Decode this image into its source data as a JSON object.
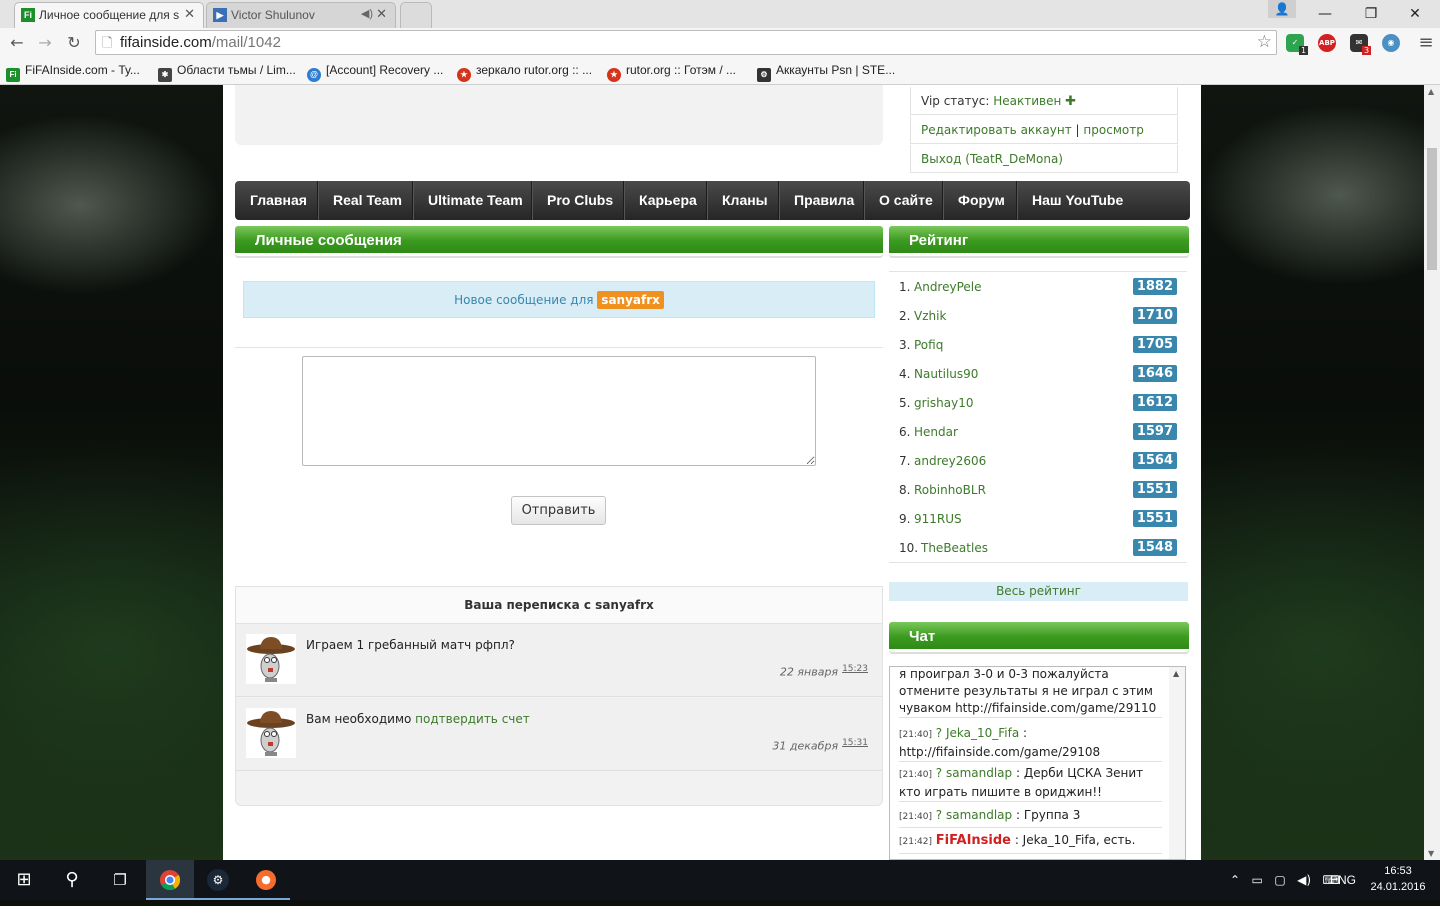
{
  "browser": {
    "tabs": [
      {
        "title": "Личное сообщение для s",
        "favicon": "fi-favicon"
      },
      {
        "title": "Victor Shulunov",
        "favicon": "video-favicon"
      }
    ],
    "url_host": "fifainside.com",
    "url_path": "/mail/1042",
    "ext_badges": {
      "shield": "1",
      "abp": "ABP",
      "mail": "3"
    },
    "bookmarks": [
      {
        "label": "FiFAInside.com - Ту...",
        "icon": "fi-favicon",
        "color": "#1b8f2a"
      },
      {
        "label": "Области тьмы / Lim...",
        "icon": "spider-icon",
        "color": "#444444"
      },
      {
        "label": "[Account] Recovery ...",
        "icon": "recovery-icon",
        "color": "#2f7dd1"
      },
      {
        "label": "зеркало rutor.org :: ...",
        "icon": "rutor-icon",
        "color": "#d4331c"
      },
      {
        "label": "rutor.org :: Готэм / ...",
        "icon": "rutor-icon",
        "color": "#d4331c"
      },
      {
        "label": "Аккаунты Psn | STE...",
        "icon": "steam-icon",
        "color": "#333333"
      }
    ]
  },
  "account": {
    "vip_label": "Vip статус:",
    "vip_value": "Неактивен",
    "edit_label": "Редактировать аккаунт",
    "separator": "|",
    "view_label": "просмотр",
    "logout_label": "Выход (TeatR_DeMona)"
  },
  "nav": [
    "Главная",
    "Real Team",
    "Ultimate Team",
    "Pro Clubs",
    "Карьера",
    "Кланы",
    "Правила",
    "О сайте",
    "Форум",
    "Наш YouTube"
  ],
  "pm": {
    "header": "Личные сообщения",
    "new_message_label": "Новое сообщение для",
    "recipient": "sanyafrx",
    "message_value": "",
    "send_label": "Отправить",
    "conversation_title": "Ваша переписка с sanyafrx",
    "messages": [
      {
        "text": "Играем 1 гребанный матч рфпл?",
        "link": "",
        "date": "22 января",
        "time": "15:23"
      },
      {
        "text": "Вам необходимо ",
        "link": "подтвердить счет",
        "date": "31 декабря",
        "time": "15:31"
      }
    ]
  },
  "rating": {
    "header": "Рейтинг",
    "entries": [
      {
        "rank": "1.",
        "name": "AndreyPele",
        "score": "1882"
      },
      {
        "rank": "2.",
        "name": "Vzhik",
        "score": "1710"
      },
      {
        "rank": "3.",
        "name": "Pofiq",
        "score": "1705"
      },
      {
        "rank": "4.",
        "name": "Nautilus90",
        "score": "1646"
      },
      {
        "rank": "5.",
        "name": "grishay10",
        "score": "1612"
      },
      {
        "rank": "6.",
        "name": "Hendar",
        "score": "1597"
      },
      {
        "rank": "7.",
        "name": "andrey2606",
        "score": "1564"
      },
      {
        "rank": "8.",
        "name": "RobinhoBLR",
        "score": "1551"
      },
      {
        "rank": "9.",
        "name": "911RUS",
        "score": "1551"
      },
      {
        "rank": "10.",
        "name": "TheBeatles",
        "score": "1548"
      }
    ],
    "all_label": "Весь рейтинг"
  },
  "chat": {
    "header": "Чат",
    "lines": [
      {
        "time": "",
        "user": "",
        "text": "я проиграл 3-0 и 0-3 пожалуйста отмените результаты я не играл с этим чуваком http://fifainside.com/game/29110",
        "admin": false
      },
      {
        "time": "[21:40]",
        "user": "? Jeka_10_Fifa",
        "text": " : http://fifainside.com/game/29108",
        "admin": false
      },
      {
        "time": "[21:40]",
        "user": "? samandlap",
        "text": " : Дерби ЦСКА Зенит кто играть пишите в ориджин!!",
        "admin": false
      },
      {
        "time": "[21:40]",
        "user": "? samandlap",
        "text": " : Группа 3",
        "admin": false
      },
      {
        "time": "[21:42]",
        "user": "FiFAInside",
        "text": " : Jeka_10_Fifa, есть.",
        "admin": true
      }
    ]
  },
  "taskbar": {
    "lang": "ENG",
    "time": "16:53",
    "date": "24.01.2016"
  },
  "colors": {
    "accent_green": "#3b9a1f",
    "link_green": "#3d7a2a",
    "score_blue": "#3a87ad",
    "recipient_orange": "#f0901e",
    "admin_red": "#d02020"
  }
}
